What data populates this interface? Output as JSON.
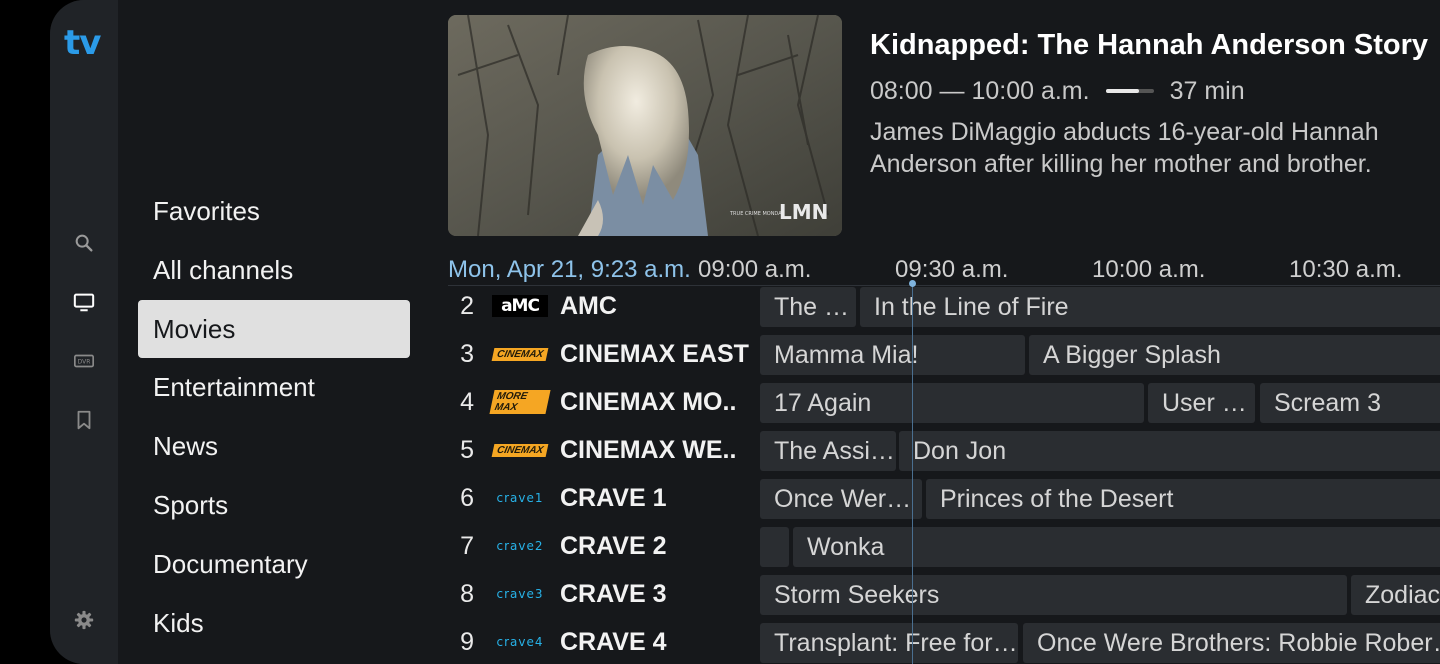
{
  "app": {
    "logo": "tv"
  },
  "rail": {
    "icons": [
      "search-icon",
      "tv-icon",
      "dvr-icon",
      "bookmark-icon",
      "gear-icon"
    ],
    "dvr_label": "DVR"
  },
  "categories": [
    "Favorites",
    "All channels",
    "Movies",
    "Entertainment",
    "News",
    "Sports",
    "Documentary",
    "Kids"
  ],
  "selected_category": "Movies",
  "preview": {
    "watermark_small": "TRUE CRIME MONDAY",
    "watermark": "LMN"
  },
  "program": {
    "title": "Kidnapped: The Hannah Anderson Story",
    "time": "08:00 — 10:00 a.m.",
    "progress_fraction": 0.7,
    "remaining": "37 min",
    "description": "James DiMaggio abducts 16-year-old Hannah Anderson after killing her mother and brother."
  },
  "timeline": {
    "current": "Mon, Apr 21, 9:23 a.m.",
    "ticks": [
      "09:00 a.m.",
      "09:30 a.m.",
      "10:00 a.m.",
      "10:30 a.m."
    ]
  },
  "channels": [
    {
      "number": "2",
      "logo": "amc",
      "logo_text": "aMC",
      "name": "AMC",
      "programs": [
        "The Shawshank Redemption",
        "In the Line of Fire"
      ]
    },
    {
      "number": "3",
      "logo": "cinemax",
      "logo_text": "CINEMAX",
      "name": "CINEMAX EAST",
      "programs": [
        "Mamma Mia!",
        "A Bigger Splash"
      ]
    },
    {
      "number": "4",
      "logo": "cinemax",
      "logo_text": "MORE MAX",
      "name": "CINEMAX MO..",
      "programs": [
        "17 Again",
        "User Friendly",
        "Scream 3"
      ]
    },
    {
      "number": "5",
      "logo": "cinemax",
      "logo_text": "CINEMAX",
      "name": "CINEMAX WE..",
      "programs": [
        "The Assistant",
        "Don Jon"
      ]
    },
    {
      "number": "6",
      "logo": "crave",
      "logo_text": "crave1",
      "name": "CRAVE 1",
      "programs": [
        "Once Were Brothers",
        "Princes of the Desert"
      ]
    },
    {
      "number": "7",
      "logo": "crave",
      "logo_text": "crave2",
      "name": "CRAVE 2",
      "programs": [
        "",
        "Wonka"
      ]
    },
    {
      "number": "8",
      "logo": "crave",
      "logo_text": "crave3",
      "name": "CRAVE 3",
      "programs": [
        "Storm Seekers",
        "Zodiac"
      ]
    },
    {
      "number": "9",
      "logo": "crave",
      "logo_text": "crave4",
      "name": "CRAVE 4",
      "programs": [
        "Transplant: Free for Life",
        "Once Were Brothers: Robbie Robertson and the Band"
      ]
    }
  ],
  "colors": {
    "accent": "#2b9be8",
    "time_accent": "#8ec3ea",
    "selected_bg": "#e0e0e0"
  }
}
